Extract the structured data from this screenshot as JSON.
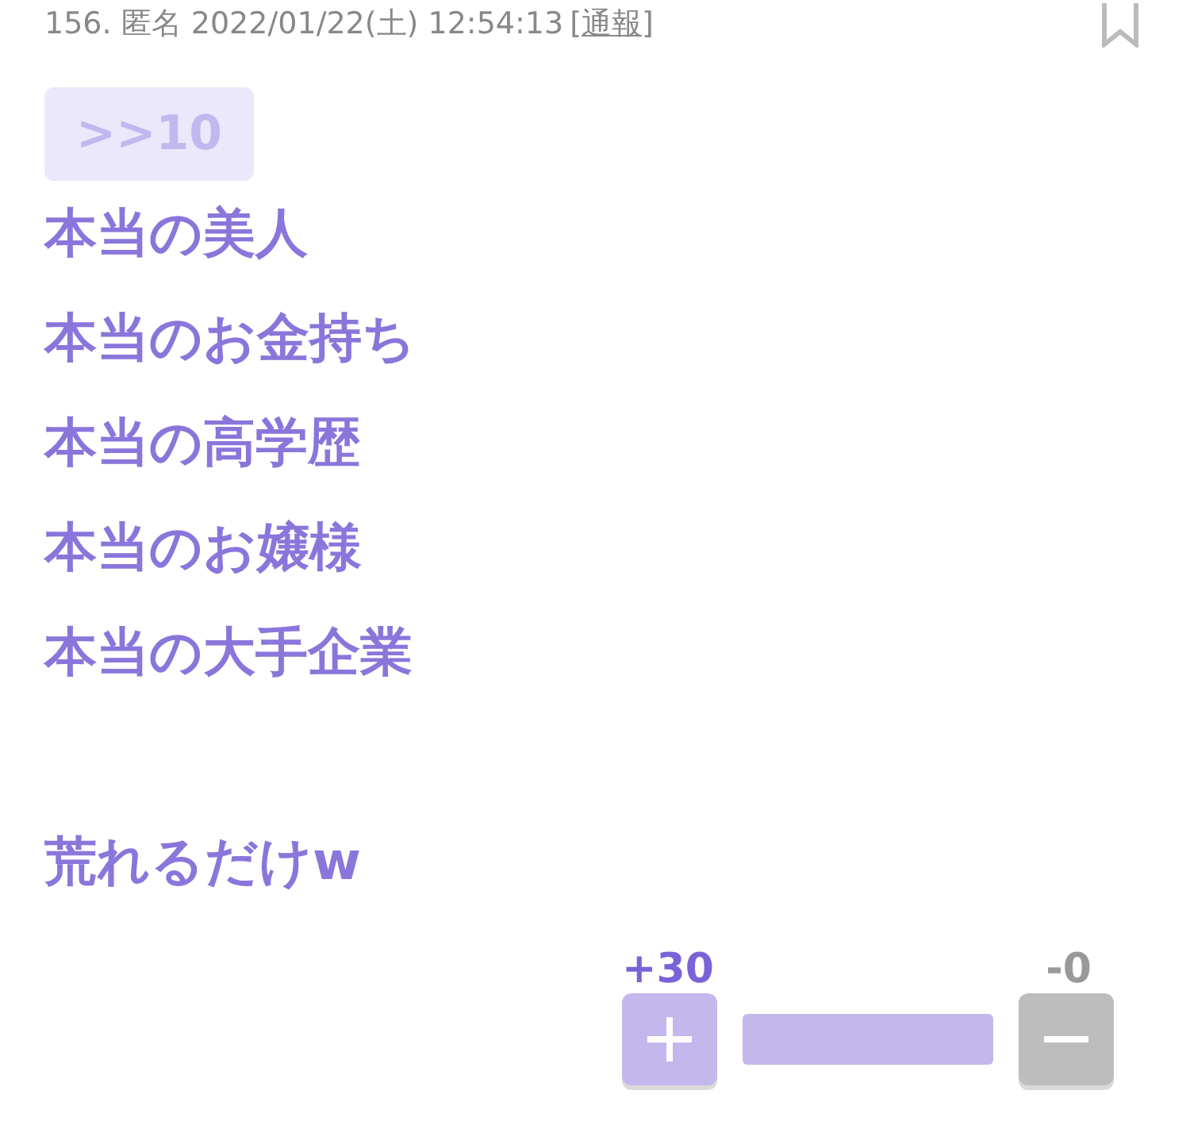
{
  "header": {
    "meta": "156. 匿名 2022/01/22(土) 12:54:13",
    "report_open": "[",
    "report_label": "通報",
    "report_close": "]",
    "bookmarked": false
  },
  "anchor": ">>10",
  "paragraphs": [
    {
      "lines": [
        "本当の美人",
        "本当のお金持ち",
        "本当の高学歴",
        "本当のお嬢様",
        "本当の大手企業"
      ]
    },
    {
      "lines": [
        "荒れるだけw"
      ]
    }
  ],
  "votes": {
    "plus": "+30",
    "minus": "-0",
    "level": 1
  }
}
